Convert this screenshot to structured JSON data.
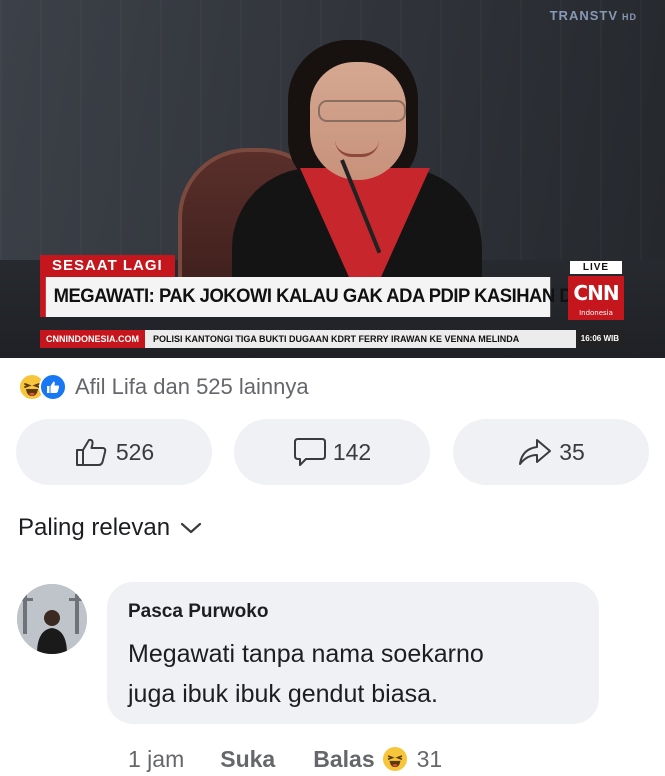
{
  "video": {
    "watermark": "TRANSTV",
    "watermark_hd": "HD",
    "badge_live": "LIVE",
    "badge_sesaat": "SESAAT LAGI",
    "headline": "MEGAWATI: PAK JOKOWI KALAU GAK ADA PDIP KASIHAN DEH",
    "logo_text": "CNN",
    "logo_subtext": "Indonesia",
    "ticker_site": "CNNINDONESIA.COM",
    "ticker_text": "POLISI KANTONGI TIGA BUKTI DUGAAN KDRT FERRY IRAWAN KE VENNA MELINDA",
    "ticker_time": "16:06 WIB"
  },
  "reactions": {
    "icons": [
      "haha-icon",
      "like-icon"
    ],
    "summary": "Afil Lifa dan 525 lainnya"
  },
  "actions": {
    "like_count": "526",
    "comment_count": "142",
    "share_count": "35"
  },
  "sort": {
    "label": "Paling relevan"
  },
  "comment": {
    "author": "Pasca Purwoko",
    "text_line1": "Megawati tanpa nama soekarno",
    "text_line2": "juga ibuk ibuk gendut biasa.",
    "time": "1 jam",
    "like_label": "Suka",
    "reply_label": "Balas",
    "reaction_icon": "haha-icon",
    "reaction_count": "31"
  },
  "colors": {
    "brand_red": "#c4161c",
    "like_blue": "#1877f2",
    "haha_yellow": "#f7c53b",
    "muted_text": "#65676b",
    "bubble_bg": "#eff1f4"
  }
}
